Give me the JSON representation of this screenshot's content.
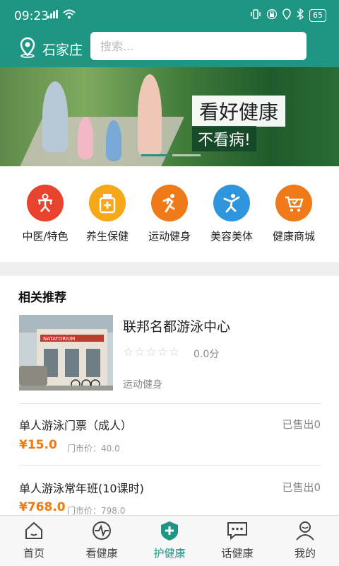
{
  "status": {
    "time": "09:23",
    "battery": "65",
    "signal": "4G"
  },
  "header": {
    "city": "石家庄",
    "search_placeholder": "搜索..."
  },
  "banner": {
    "line1": "看好健康",
    "line2": "不看病!"
  },
  "categories": [
    {
      "label": "中医/特色",
      "color": "#e8432c",
      "icon": "tcm-figure-icon"
    },
    {
      "label": "养生保健",
      "color": "#f5a818",
      "icon": "medicine-bottle-icon"
    },
    {
      "label": "运动健身",
      "color": "#f07a1a",
      "icon": "running-figure-icon"
    },
    {
      "label": "美容美体",
      "color": "#2f95dd",
      "icon": "dancing-figure-icon"
    },
    {
      "label": "健康商城",
      "color": "#f07a1a",
      "icon": "shopping-cart-icon"
    }
  ],
  "recommend": {
    "title": "相关推荐",
    "venue": {
      "name": "联邦名都游泳中心",
      "score": "0.0分",
      "rating": 0,
      "category": "运动健身",
      "sign": "NATATORIUM"
    },
    "items": [
      {
        "title": "单人游泳门票（成人）",
        "sold": "已售出0",
        "price": "¥15.0",
        "market_price": "门市价：40.0"
      },
      {
        "title": "单人游泳常年班(10课时)",
        "sold": "已售出0",
        "price": "¥768.0",
        "market_price": "门市价：798.0"
      }
    ]
  },
  "nav": [
    {
      "label": "首页",
      "icon": "home-icon",
      "active": false
    },
    {
      "label": "看健康",
      "icon": "health-view-icon",
      "active": false
    },
    {
      "label": "护健康",
      "icon": "medical-cross-icon",
      "active": true
    },
    {
      "label": "话健康",
      "icon": "chat-bubble-icon",
      "active": false
    },
    {
      "label": "我的",
      "icon": "user-icon",
      "active": false
    }
  ],
  "colors": {
    "primary": "#1f9684",
    "price": "#f07a0f"
  }
}
